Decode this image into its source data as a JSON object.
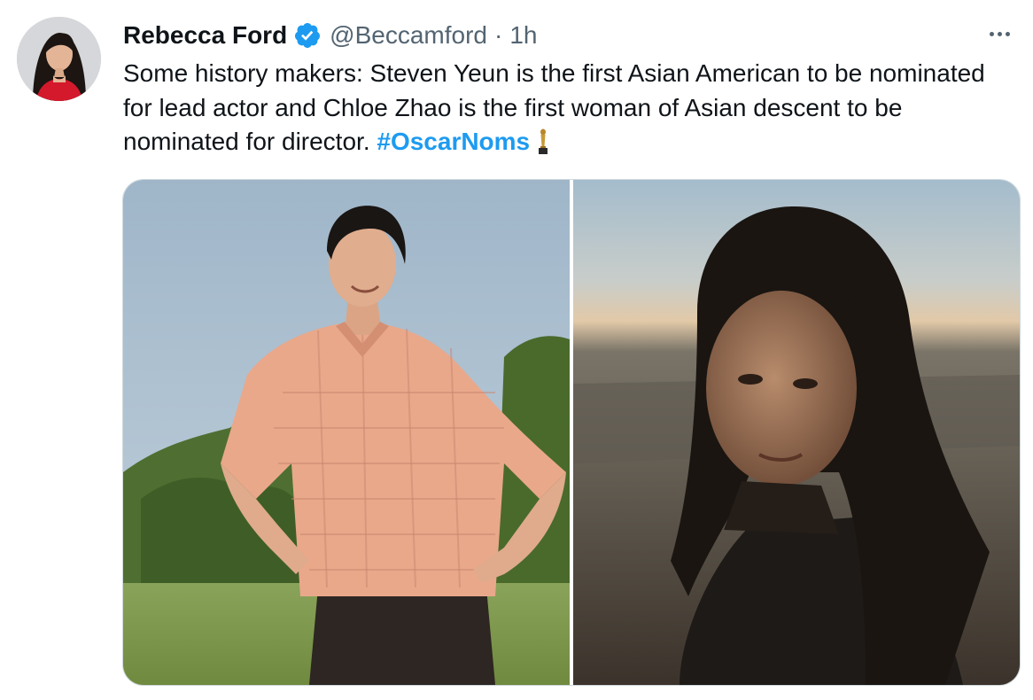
{
  "tweet": {
    "author": {
      "display_name": "Rebecca Ford",
      "handle": "@Beccamford",
      "verified": true,
      "avatar_icon": "profile-photo"
    },
    "separator": "·",
    "timestamp": "1h",
    "more_icon": "more-horizontal-icon",
    "text": "Some history makers: Steven Yeun is the first Asian American to be nominated for lead actor and Chloe Zhao is the first woman of Asian descent to be nominated for director.",
    "hashtag": "#OscarNoms",
    "emoji_icon": "oscar-trophy-icon",
    "media": {
      "count": 2,
      "items": [
        "photo-man-in-field",
        "photo-woman-at-dusk"
      ]
    },
    "colors": {
      "accent": "#1d9bf0",
      "text": "#0f1419",
      "muted": "#536471"
    }
  }
}
